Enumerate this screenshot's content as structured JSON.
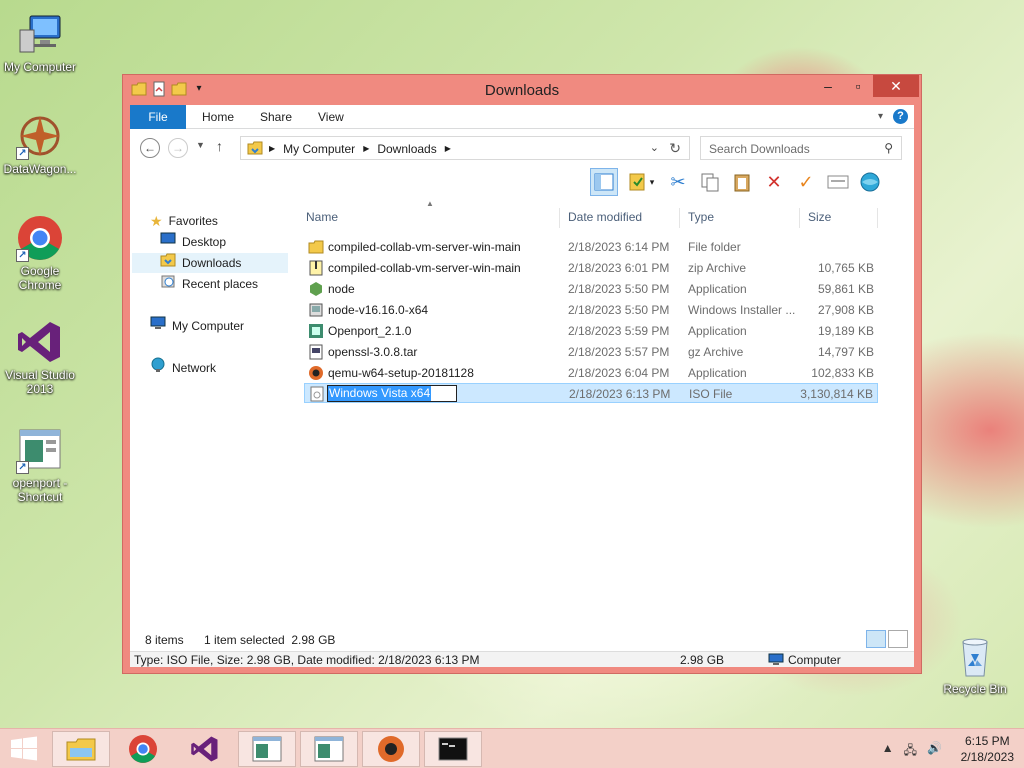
{
  "desktop": {
    "icons": [
      {
        "label": "My Computer"
      },
      {
        "label": "DataWagon..."
      },
      {
        "label": "Google Chrome"
      },
      {
        "label": "Visual Studio 2013"
      },
      {
        "label": "openport - Shortcut"
      },
      {
        "label": "Recycle Bin"
      }
    ]
  },
  "window": {
    "title": "Downloads",
    "tabs": [
      "File",
      "Home",
      "Share",
      "View"
    ],
    "breadcrumb": [
      "My Computer",
      "Downloads"
    ],
    "search_placeholder": "Search Downloads",
    "help_label": "?"
  },
  "nav": {
    "favorites": "Favorites",
    "desktop": "Desktop",
    "downloads": "Downloads",
    "recent": "Recent places",
    "computer": "My Computer",
    "network": "Network"
  },
  "columns": {
    "name": "Name",
    "date": "Date modified",
    "type": "Type",
    "size": "Size"
  },
  "files": [
    {
      "name": "compiled-collab-vm-server-win-main",
      "date": "2/18/2023 6:14 PM",
      "type": "File folder",
      "size": "",
      "icon": "folder-icon"
    },
    {
      "name": "compiled-collab-vm-server-win-main",
      "date": "2/18/2023 6:01 PM",
      "type": "zip Archive",
      "size": "10,765 KB",
      "icon": "zip-icon"
    },
    {
      "name": "node",
      "date": "2/18/2023 5:50 PM",
      "type": "Application",
      "size": "59,861 KB",
      "icon": "node-icon"
    },
    {
      "name": "node-v16.16.0-x64",
      "date": "2/18/2023 5:50 PM",
      "type": "Windows Installer ...",
      "size": "27,908 KB",
      "icon": "installer-icon"
    },
    {
      "name": "Openport_2.1.0",
      "date": "2/18/2023 5:59 PM",
      "type": "Application",
      "size": "19,189 KB",
      "icon": "openport-icon"
    },
    {
      "name": "openssl-3.0.8.tar",
      "date": "2/18/2023 5:57 PM",
      "type": "gz Archive",
      "size": "14,797 KB",
      "icon": "archive-icon"
    },
    {
      "name": "qemu-w64-setup-20181128",
      "date": "2/18/2023 6:04 PM",
      "type": "Application",
      "size": "102,833 KB",
      "icon": "qemu-icon"
    },
    {
      "name": "Windows Vista x64",
      "date": "2/18/2023 6:13 PM",
      "type": "ISO File",
      "size": "3,130,814 KB",
      "icon": "iso-icon"
    }
  ],
  "status": {
    "items": "8 items",
    "selected": "1 item selected  2.98 GB",
    "details": "Type: ISO File, Size: 2.98 GB, Date modified: 2/18/2023 6:13 PM",
    "size": "2.98 GB",
    "location": "Computer"
  },
  "clock": {
    "time": "6:15 PM",
    "date": "2/18/2023"
  }
}
